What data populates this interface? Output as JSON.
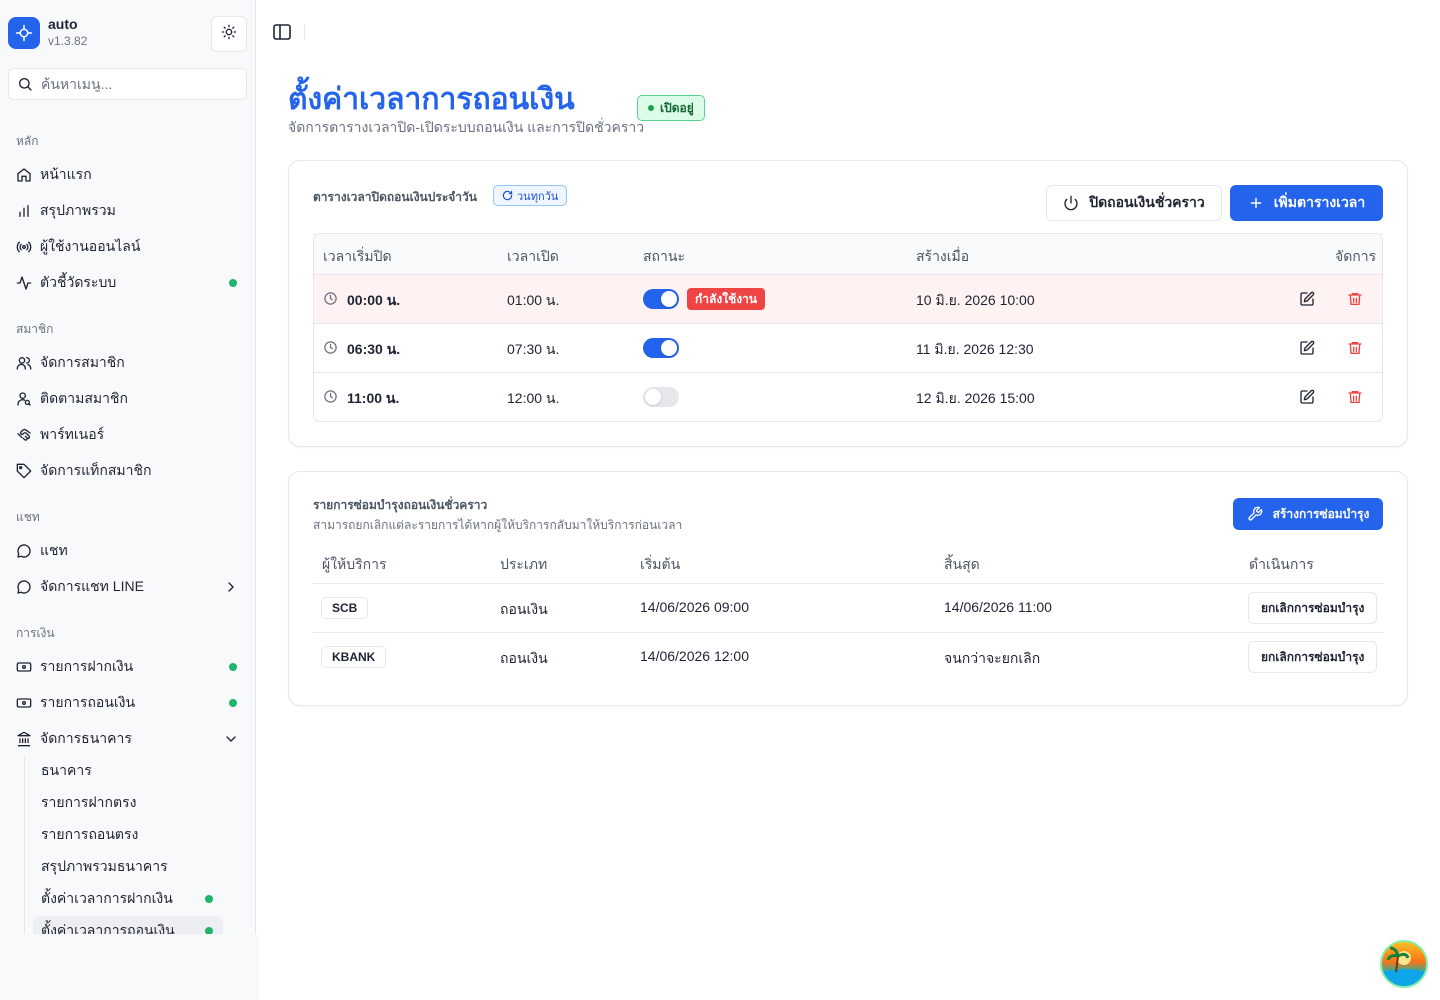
{
  "app": {
    "name": "auto",
    "version": "v1.3.82"
  },
  "search": {
    "placeholder": "ค้นหาเมนู..."
  },
  "sidebar": {
    "groups": [
      {
        "label": "หลัก",
        "items": [
          {
            "label": "หน้าแรก",
            "icon": "home-icon"
          },
          {
            "label": "สรุปภาพรวม",
            "icon": "bar-chart-icon"
          },
          {
            "label": "ผู้ใช้งานออนไลน์",
            "icon": "radio-icon"
          },
          {
            "label": "ตัวชี้วัดระบบ",
            "icon": "activity-icon",
            "dot": true
          }
        ]
      },
      {
        "label": "สมาชิก",
        "items": [
          {
            "label": "จัดการสมาชิก",
            "icon": "users-icon"
          },
          {
            "label": "ติดตามสมาชิก",
            "icon": "user-search-icon"
          },
          {
            "label": "พาร์ทเนอร์",
            "icon": "handshake-icon"
          },
          {
            "label": "จัดการแท็กสมาชิก",
            "icon": "tag-icon"
          }
        ]
      },
      {
        "label": "แชท",
        "items": [
          {
            "label": "แชท",
            "icon": "message-circle-icon"
          },
          {
            "label": "จัดการแชท LINE",
            "icon": "message-circle-icon",
            "chevron": "right"
          }
        ]
      },
      {
        "label": "การเงิน",
        "items": [
          {
            "label": "รายการฝากเงิน",
            "icon": "banknote-icon",
            "dot": true
          },
          {
            "label": "รายการถอนเงิน",
            "icon": "banknote-icon",
            "dot": true
          },
          {
            "label": "จัดการธนาคาร",
            "icon": "landmark-icon",
            "chevron": "down"
          }
        ]
      }
    ],
    "bank_sub_items": [
      {
        "label": "ธนาคาร"
      },
      {
        "label": "รายการฝากตรง"
      },
      {
        "label": "รายการถอนตรง"
      },
      {
        "label": "สรุปภาพรวมธนาคาร"
      },
      {
        "label": "ตั้งค่าเวลาการฝากเงิน",
        "dot": true
      },
      {
        "label": "ตั้งค่าเวลาการถอนเงิน",
        "dot": true,
        "active": true
      }
    ]
  },
  "header": {
    "title": "ตั้งค่าเวลาการถอนเงิน",
    "subtitle": "จัดการตารางเวลาปิด-เปิดระบบถอนเงิน และการปิดชั่วคราว",
    "status": "เปิดอยู่"
  },
  "schedule": {
    "title": "ตารางเวลาปิดถอนเงินประจำวัน",
    "repeat_badge": "วนทุกวัน",
    "temp_close_label": "ปิดถอนเงินชั่วคราว",
    "add_label": "เพิ่มตารางเวลา",
    "columns": [
      "เวลาเริ่มปิด",
      "เวลาเปิด",
      "สถานะ",
      "สร้างเมื่อ",
      "จัดการ"
    ],
    "rows": [
      {
        "start": "00:00 น.",
        "end": "01:00 น.",
        "enabled": true,
        "badge": "กำลังใช้งาน",
        "created": "10 มิ.ย. 2026 10:00"
      },
      {
        "start": "06:30 น.",
        "end": "07:30 น.",
        "enabled": true,
        "badge": "",
        "created": "11 มิ.ย. 2026 12:30"
      },
      {
        "start": "11:00 น.",
        "end": "12:00 น.",
        "enabled": false,
        "badge": "",
        "created": "12 มิ.ย. 2026 15:00"
      }
    ]
  },
  "maintenance": {
    "title": "รายการซ่อมบำรุงถอนเงินชั่วคราว",
    "desc": "สามารถยกเลิกแต่ละรายการได้หากผู้ให้บริการกลับมาให้บริการก่อนเวลา",
    "create_label": "สร้างการซ่อมบำรุง",
    "columns": [
      "ผู้ให้บริการ",
      "ประเภท",
      "เริ่มต้น",
      "สิ้นสุด",
      "ดำเนินการ"
    ],
    "rows": [
      {
        "provider": "SCB",
        "type": "ถอนเงิน",
        "start": "14/06/2026 09:00",
        "end": "14/06/2026 11:00",
        "action": "ยกเลิกการซ่อมบำรุง"
      },
      {
        "provider": "KBANK",
        "type": "ถอนเงิน",
        "start": "14/06/2026 12:00",
        "end": "จนกว่าจะยกเลิก",
        "action": "ยกเลิกการซ่อมบำรุง"
      }
    ]
  },
  "colors": {
    "primary": "#2463eb",
    "danger": "#ef4444",
    "success": "#1fb46c"
  }
}
